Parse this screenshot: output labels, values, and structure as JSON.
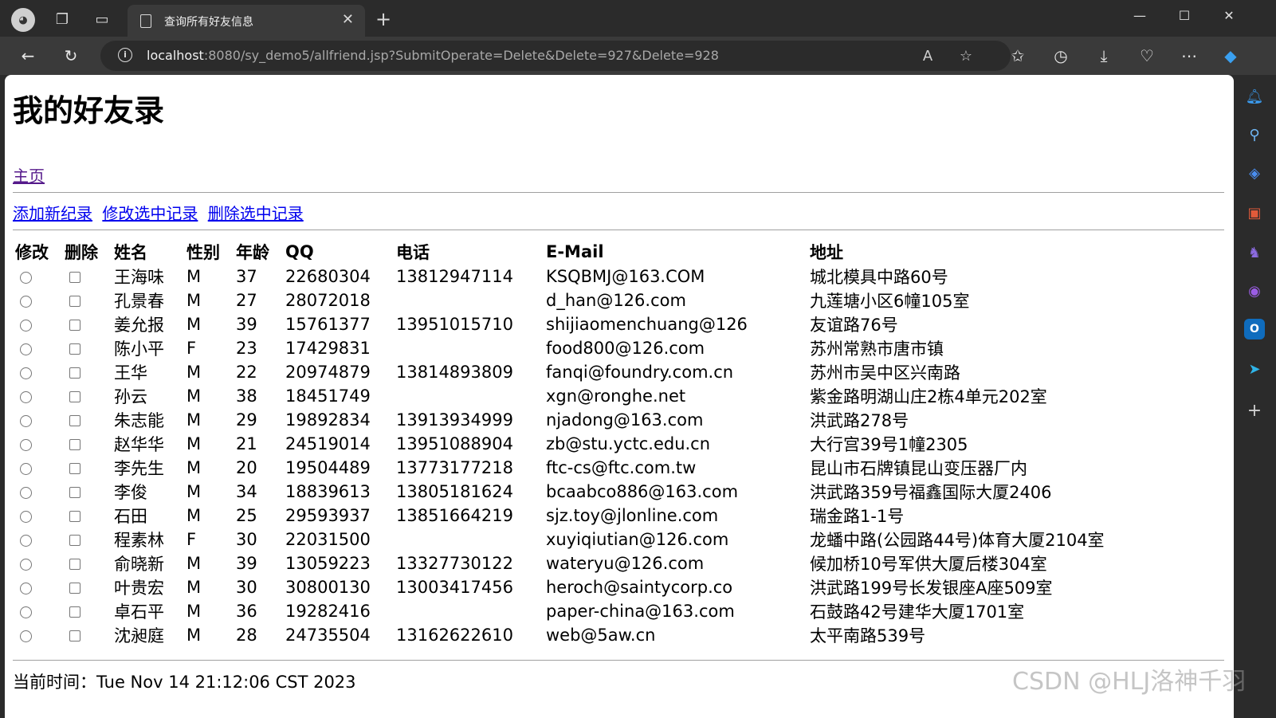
{
  "browser": {
    "tab_title": "查询所有好友信息",
    "url_host": "localhost",
    "url_rest": ":8080/sy_demo5/allfriend.jsp?SubmitOperate=Delete&Delete=927&Delete=928"
  },
  "page": {
    "title": "我的好友录",
    "home_link": "主页",
    "actions": {
      "add": "添加新纪录",
      "edit": "修改选中记录",
      "delete": "删除选中记录"
    },
    "table": {
      "headers": [
        "修改",
        "删除",
        "姓名",
        "性别",
        "年龄",
        "QQ",
        "电话",
        "E-Mail",
        "地址"
      ],
      "rows": [
        {
          "name": "王海味",
          "gender": "M",
          "age": "37",
          "qq": "22680304",
          "phone": "13812947114",
          "email": "KSQBMJ@163.COM",
          "address": "城北模具中路60号"
        },
        {
          "name": "孔景春",
          "gender": "M",
          "age": "27",
          "qq": "28072018",
          "phone": "",
          "email": "d_han@126.com",
          "address": "九莲塘小区6幢105室"
        },
        {
          "name": "姜允报",
          "gender": "M",
          "age": "39",
          "qq": "15761377",
          "phone": "13951015710",
          "email": "shijiaomenchuang@126",
          "address": "友谊路76号"
        },
        {
          "name": "陈小平",
          "gender": "F",
          "age": "23",
          "qq": "17429831",
          "phone": "",
          "email": "food800@126.com",
          "address": "苏州常熟市唐市镇"
        },
        {
          "name": "王华",
          "gender": "M",
          "age": "22",
          "qq": "20974879",
          "phone": "13814893809",
          "email": "fanqi@foundry.com.cn",
          "address": "苏州市吴中区兴南路"
        },
        {
          "name": "孙云",
          "gender": "M",
          "age": "38",
          "qq": "18451749",
          "phone": "",
          "email": "xgn@ronghe.net",
          "address": "紫金路明湖山庄2栋4单元202室"
        },
        {
          "name": "朱志能",
          "gender": "M",
          "age": "29",
          "qq": "19892834",
          "phone": "13913934999",
          "email": "njadong@163.com",
          "address": "洪武路278号"
        },
        {
          "name": "赵华华",
          "gender": "M",
          "age": "21",
          "qq": "24519014",
          "phone": "13951088904",
          "email": "zb@stu.yctc.edu.cn",
          "address": "大行宫39号1幢2305"
        },
        {
          "name": "李先生",
          "gender": "M",
          "age": "20",
          "qq": "19504489",
          "phone": "13773177218",
          "email": "ftc-cs@ftc.com.tw",
          "address": "昆山市石牌镇昆山变压器厂内"
        },
        {
          "name": "李俊",
          "gender": "M",
          "age": "34",
          "qq": "18839613",
          "phone": "13805181624",
          "email": "bcaabco886@163.com",
          "address": "洪武路359号福鑫国际大厦2406"
        },
        {
          "name": "石田",
          "gender": "M",
          "age": "25",
          "qq": "29593937",
          "phone": "13851664219",
          "email": "sjz.toy@jlonline.com",
          "address": "瑞金路1-1号"
        },
        {
          "name": "程素林",
          "gender": "F",
          "age": "30",
          "qq": "22031500",
          "phone": "",
          "email": "xuyiqiutian@126.com",
          "address": "龙蟠中路(公园路44号)体育大厦2104室"
        },
        {
          "name": "俞晓新",
          "gender": "M",
          "age": "39",
          "qq": "13059223",
          "phone": "13327730122",
          "email": "wateryu@126.com",
          "address": "候加桥10号军供大厦后楼304室"
        },
        {
          "name": "叶贵宏",
          "gender": "M",
          "age": "30",
          "qq": "30800130",
          "phone": "13003417456",
          "email": "heroch@saintycorp.co",
          "address": "洪武路199号长发银座A座509室"
        },
        {
          "name": "卓石平",
          "gender": "M",
          "age": "36",
          "qq": "19282416",
          "phone": "",
          "email": "paper-china@163.com",
          "address": "石鼓路42号建华大厦1701室"
        },
        {
          "name": "沈昶庭",
          "gender": "M",
          "age": "28",
          "qq": "24735504",
          "phone": "13162622610",
          "email": "web@5aw.cn",
          "address": "太平南路539号"
        }
      ]
    },
    "footer": "当前时间：Tue Nov 14 21:12:06 CST 2023"
  },
  "watermark": "CSDN @HLJ洛神千羽",
  "icons": {
    "window_controls": [
      "minimize-icon",
      "maximize-icon",
      "close-icon"
    ],
    "sidebar": [
      "bell-icon",
      "search-icon",
      "tag-icon",
      "toolbox-icon",
      "games-icon",
      "office-icon",
      "outlook-icon",
      "send-icon",
      "add-icon"
    ]
  }
}
